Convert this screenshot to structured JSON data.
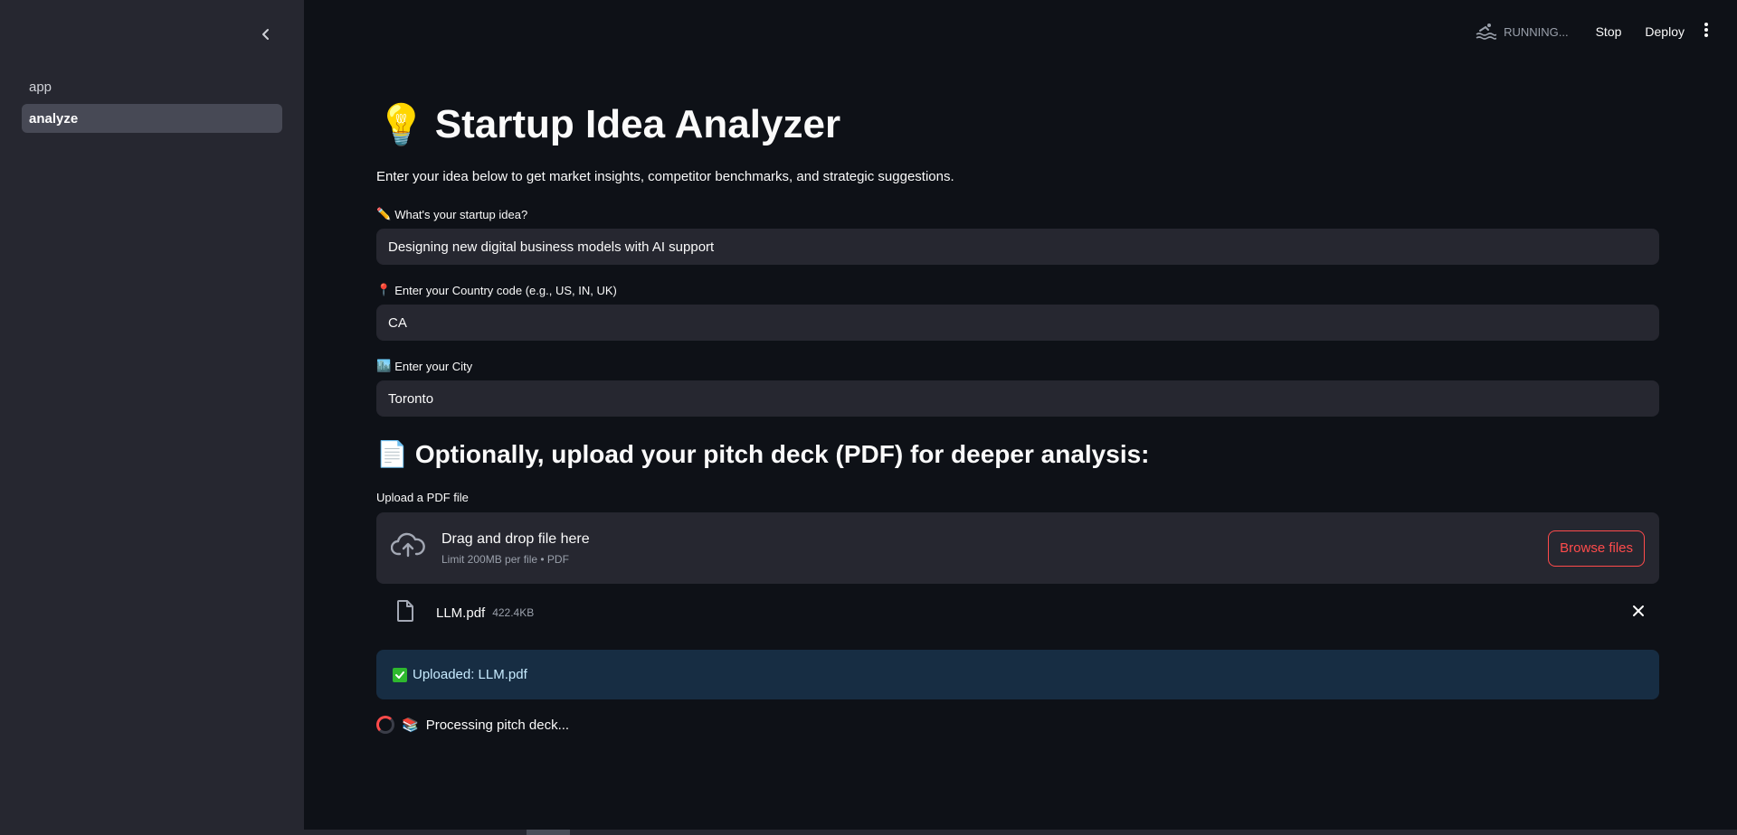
{
  "sidebar": {
    "items": [
      {
        "label": "app",
        "active": false
      },
      {
        "label": "analyze",
        "active": true
      }
    ]
  },
  "topbar": {
    "status": "RUNNING...",
    "stop_label": "Stop",
    "deploy_label": "Deploy"
  },
  "main": {
    "title_emoji": "💡",
    "title": "Startup Idea Analyzer",
    "subtitle": "Enter your idea below to get market insights, competitor benchmarks, and strategic suggestions.",
    "fields": [
      {
        "emoji": "✏️",
        "label": "What's your startup idea?",
        "value": "Designing new digital business models with AI support"
      },
      {
        "emoji": "📍",
        "label": "Enter your Country code (e.g., US, IN, UK)",
        "value": "CA"
      },
      {
        "emoji": "🏙️",
        "label": "Enter your City",
        "value": "Toronto"
      }
    ],
    "section_emoji": "📄",
    "section_heading": "Optionally, upload your pitch deck (PDF) for deeper analysis:",
    "uploader": {
      "label": "Upload a PDF file",
      "drag_text": "Drag and drop file here",
      "limit_text": "Limit 200MB per file • PDF",
      "browse_label": "Browse files"
    },
    "file": {
      "name": "LLM.pdf",
      "size": "422.4KB"
    },
    "success_text": "Uploaded: LLM.pdf",
    "processing_emoji": "📚",
    "processing_text": "Processing pitch deck..."
  },
  "colors": {
    "background": "#0e1117",
    "sidebar": "#262730",
    "accent": "#ff4b4b",
    "info_bg": "#172d43",
    "success_check": "#2eb82e"
  }
}
